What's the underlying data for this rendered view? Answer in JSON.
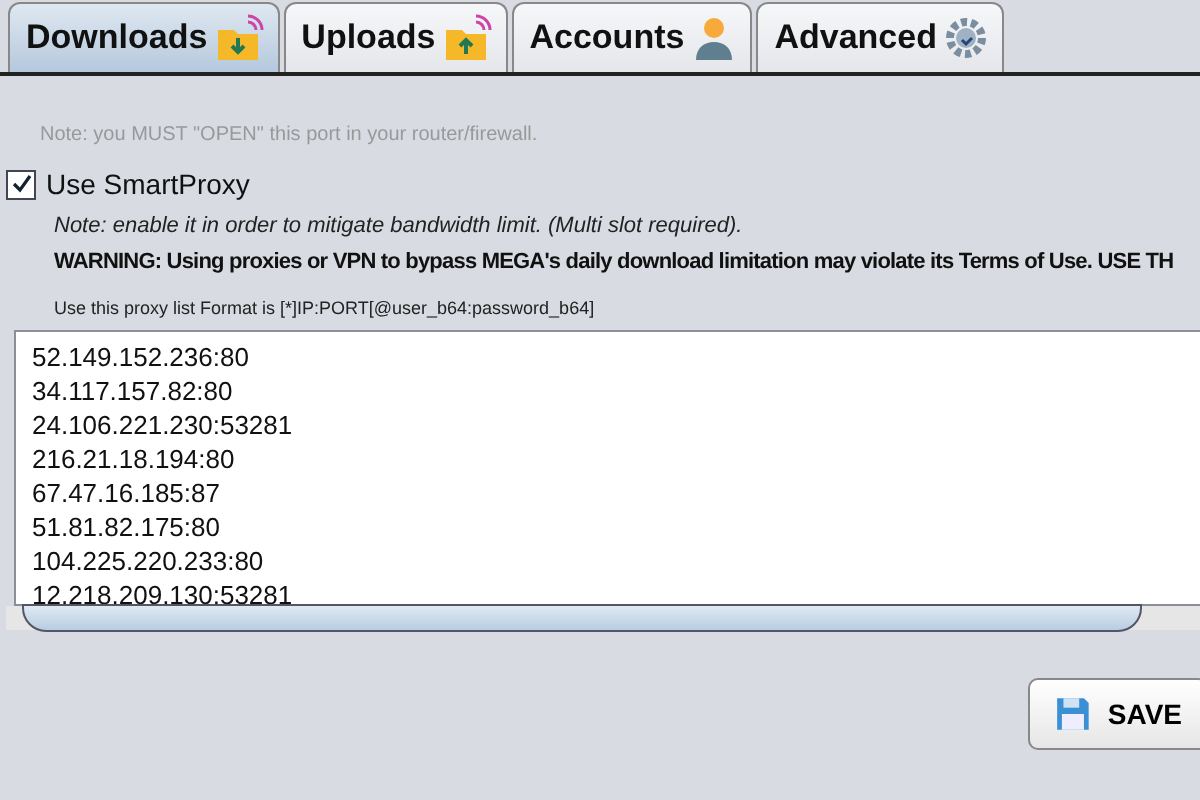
{
  "tabs": [
    {
      "label": "Downloads",
      "selected": true,
      "kind": "download"
    },
    {
      "label": "Uploads",
      "selected": false,
      "kind": "upload"
    },
    {
      "label": "Accounts",
      "selected": false,
      "kind": "user"
    },
    {
      "label": "Advanced",
      "selected": false,
      "kind": "gear"
    }
  ],
  "port_note": "Note: you MUST \"OPEN\" this port in your router/firewall.",
  "smartproxy": {
    "label": "Use SmartProxy",
    "checked": true
  },
  "proxy_note": "Note: enable it in order to mitigate bandwidth limit. (Multi slot required).",
  "warning": "WARNING: Using proxies or VPN to bypass MEGA's daily download limitation may violate its Terms of Use. USE TH",
  "format_hint": "Use this proxy list Format is [*]IP:PORT[@user_b64:password_b64]",
  "proxy_list": [
    "52.149.152.236:80",
    "34.117.157.82:80",
    "24.106.221.230:53281",
    "216.21.18.194:80",
    "67.47.16.185:87",
    "51.81.82.175:80",
    "104.225.220.233:80",
    "12.218.209.130:53281"
  ],
  "save_button": "SAVE"
}
